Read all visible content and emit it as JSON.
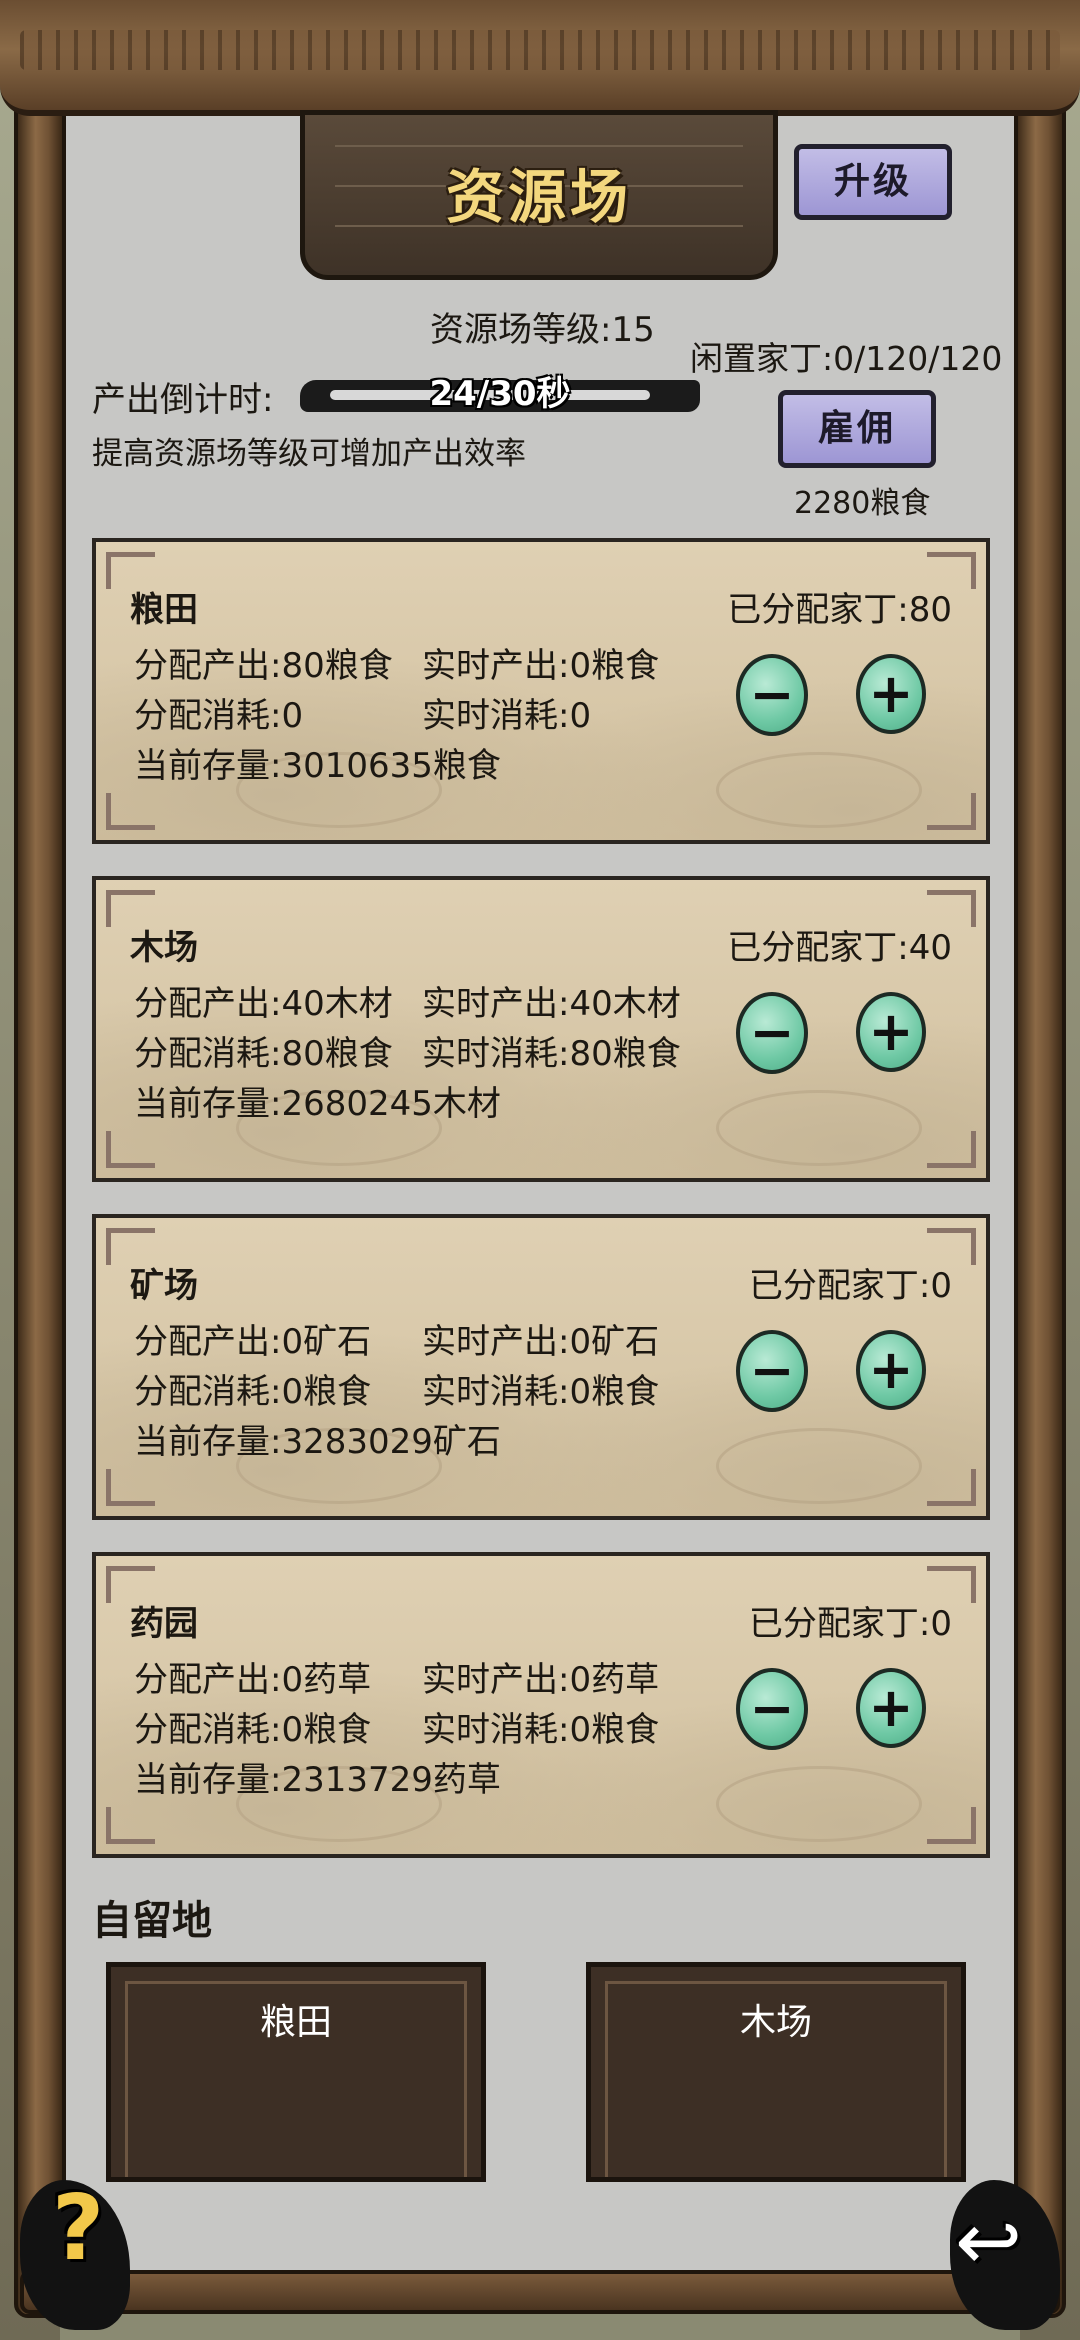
{
  "title": "资源场",
  "upgrade_label": "升级",
  "level_text": "资源场等级:15",
  "idle_workers_text": "闲置家丁:0/120/120",
  "countdown_label": "产出倒计时:",
  "countdown_value": "24/30秒",
  "tip": "提高资源场等级可增加产出效率",
  "hire_label": "雇佣",
  "hire_cost": "2280粮食",
  "cards": [
    {
      "name": "粮田",
      "assigned": "已分配家丁:80",
      "alloc_output": "分配产出:80粮食",
      "real_output": "实时产出:0粮食",
      "alloc_consume": "分配消耗:0",
      "real_consume": "实时消耗:0",
      "stock": "当前存量:3010635粮食"
    },
    {
      "name": "木场",
      "assigned": "已分配家丁:40",
      "alloc_output": "分配产出:40木材",
      "real_output": "实时产出:40木材",
      "alloc_consume": "分配消耗:80粮食",
      "real_consume": "实时消耗:80粮食",
      "stock": "当前存量:2680245木材"
    },
    {
      "name": "矿场",
      "assigned": "已分配家丁:0",
      "alloc_output": "分配产出:0矿石",
      "real_output": "实时产出:0矿石",
      "alloc_consume": "分配消耗:0粮食",
      "real_consume": "实时消耗:0粮食",
      "stock": "当前存量:3283029矿石"
    },
    {
      "name": "药园",
      "assigned": "已分配家丁:0",
      "alloc_output": "分配产出:0药草",
      "real_output": "实时产出:0药草",
      "alloc_consume": "分配消耗:0粮食",
      "real_consume": "实时消耗:0粮食",
      "stock": "当前存量:2313729药草"
    }
  ],
  "minus_symbol": "−",
  "plus_symbol": "+",
  "private_land_label": "自留地",
  "plots": [
    "粮田",
    "木场"
  ],
  "help_symbol": "?",
  "back_symbol": "↩",
  "colors": {
    "title_gold": "#f3d77e",
    "button_purple": "#b1abe0",
    "jade": "#6fc9a5",
    "card_bg": "#d8c8aa"
  }
}
